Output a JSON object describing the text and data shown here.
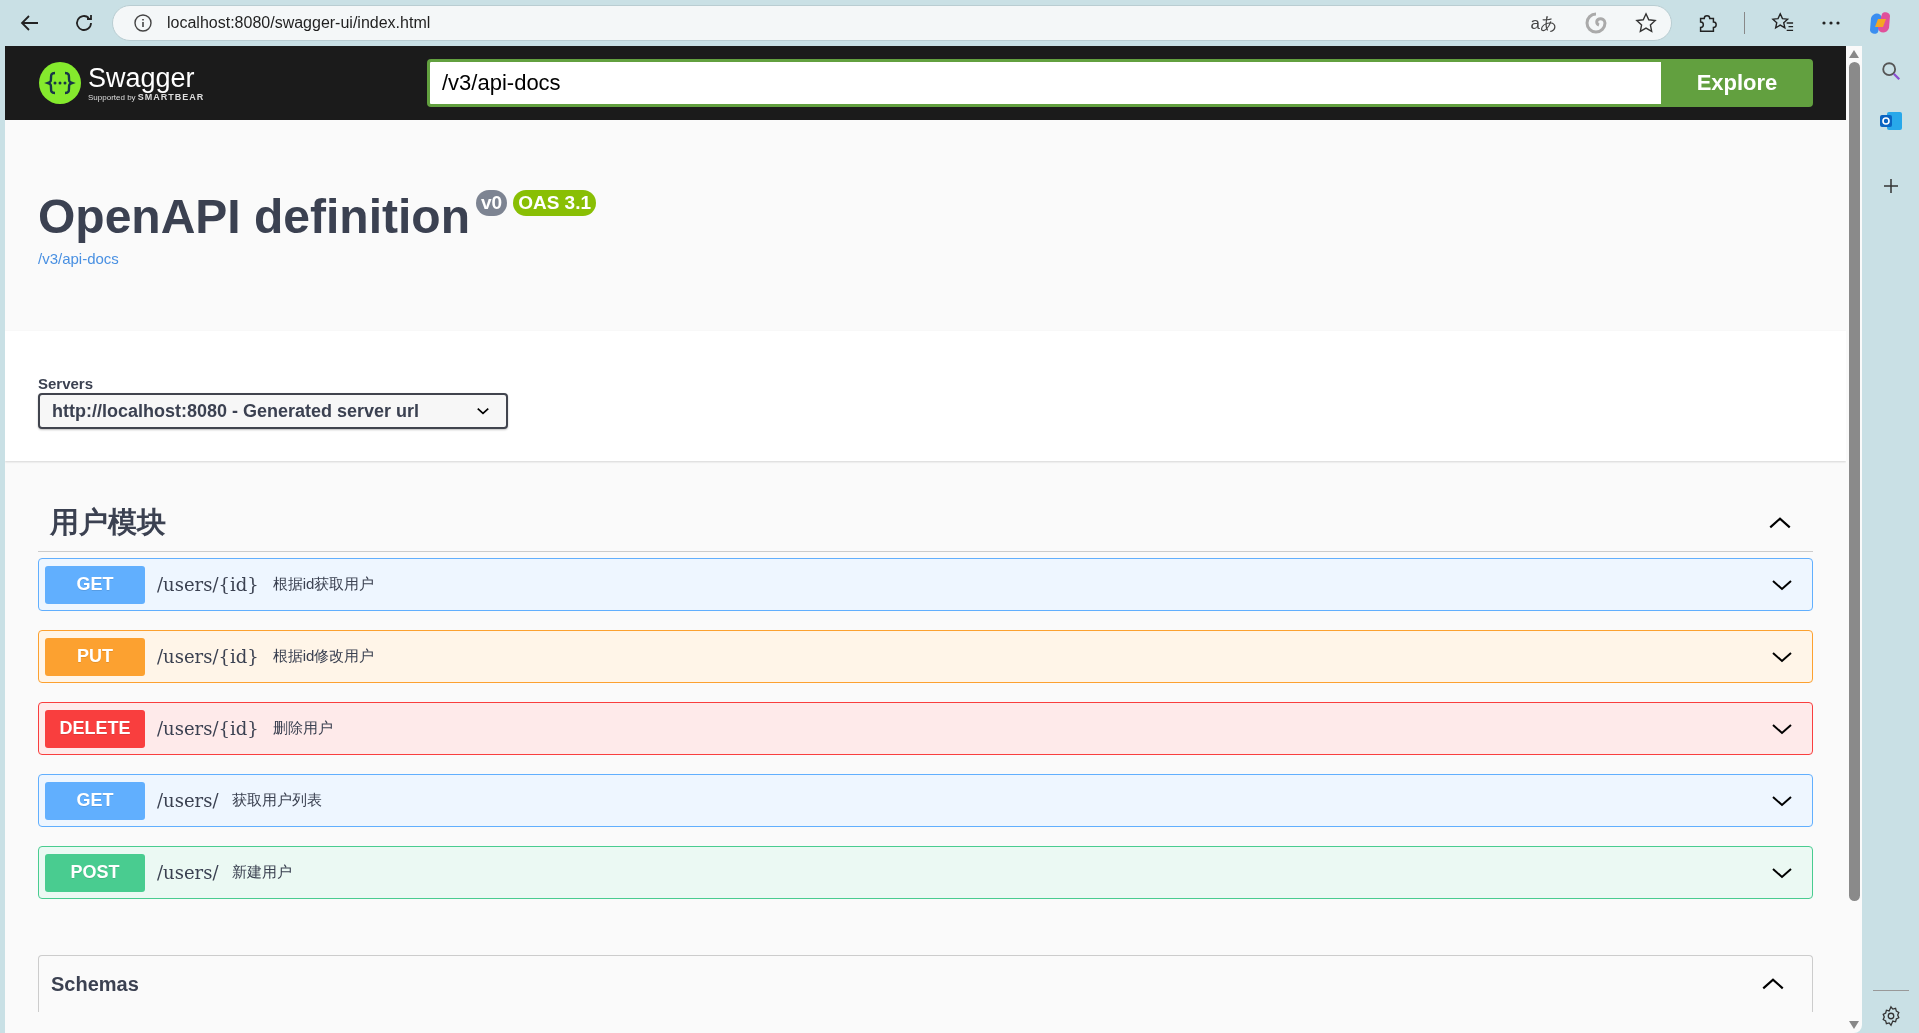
{
  "browser": {
    "url": "localhost:8080/swagger-ui/index.html",
    "translate_glyph": "aあ"
  },
  "topbar": {
    "logo_text": "Swagger",
    "logo_sub_prefix": "Supported by",
    "logo_sub_brand": "SMARTBEAR",
    "url_input": "/v3/api-docs",
    "explore_button": "Explore"
  },
  "info": {
    "title": "OpenAPI definition",
    "version": "v0",
    "oas": "OAS 3.1",
    "spec_link": "/v3/api-docs"
  },
  "servers": {
    "label": "Servers",
    "selected": "http://localhost:8080 - Generated server url"
  },
  "tags": [
    {
      "name": "用户模块",
      "expanded": true,
      "operations": [
        {
          "method": "GET",
          "color": "#61affe",
          "path": "/users/{id}",
          "summary": "根据id获取用户",
          "expanded": false
        },
        {
          "method": "PUT",
          "color": "#fca130",
          "path": "/users/{id}",
          "summary": "根据id修改用户",
          "expanded": false
        },
        {
          "method": "DELETE",
          "color": "#f93e3e",
          "path": "/users/{id}",
          "summary": "删除用户",
          "expanded": false
        },
        {
          "method": "GET",
          "color": "#61affe",
          "path": "/users/",
          "summary": "获取用户列表",
          "expanded": false
        },
        {
          "method": "POST",
          "color": "#49cc90",
          "path": "/users/",
          "summary": "新建用户",
          "expanded": false
        }
      ]
    }
  ],
  "schemas": {
    "title": "Schemas",
    "expanded": true
  }
}
